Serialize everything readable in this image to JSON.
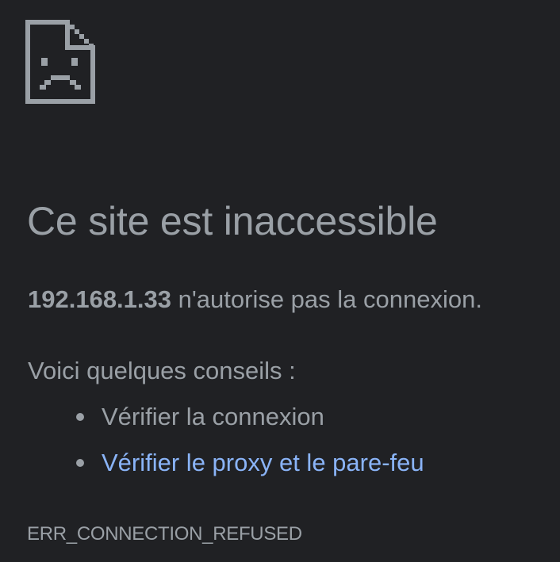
{
  "icon": {
    "name": "sad-page-icon",
    "color": "#9aa0a6"
  },
  "error": {
    "title": "Ce site est inaccessible",
    "host": "192.168.1.33",
    "message": " n'autorise pas la connexion.",
    "code": "ERR_CONNECTION_REFUSED"
  },
  "suggestions": {
    "heading": "Voici quelques conseils :",
    "items": [
      {
        "label": "Vérifier la connexion",
        "is_link": false
      },
      {
        "label": "Vérifier le proxy et le pare-feu",
        "is_link": true
      }
    ]
  },
  "colors": {
    "background": "#202124",
    "text": "#9aa0a6",
    "link": "#8ab4f8"
  }
}
